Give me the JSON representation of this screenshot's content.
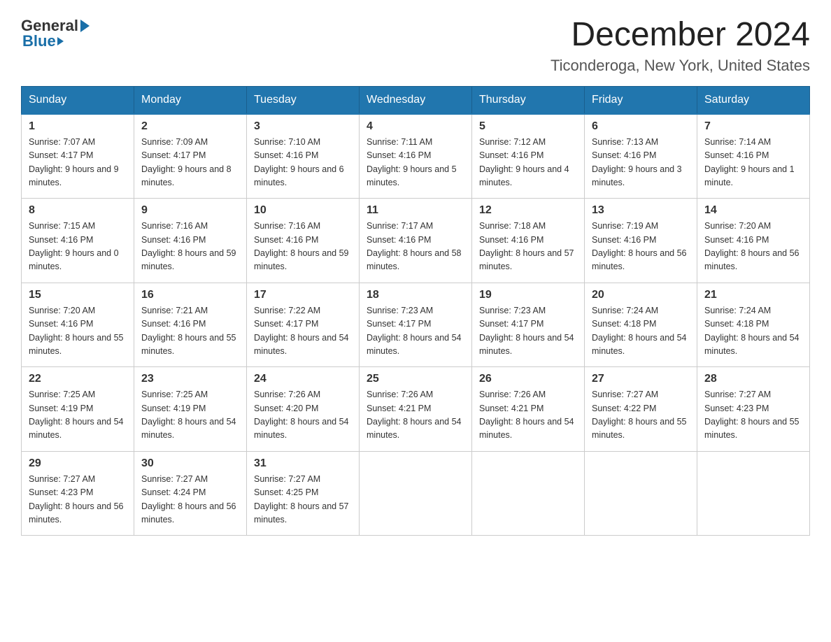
{
  "header": {
    "logo_general": "General",
    "logo_blue": "Blue",
    "title": "December 2024",
    "subtitle": "Ticonderoga, New York, United States"
  },
  "calendar": {
    "days_of_week": [
      "Sunday",
      "Monday",
      "Tuesday",
      "Wednesday",
      "Thursday",
      "Friday",
      "Saturday"
    ],
    "weeks": [
      [
        {
          "day": 1,
          "sunrise": "7:07 AM",
          "sunset": "4:17 PM",
          "daylight": "9 hours and 9 minutes."
        },
        {
          "day": 2,
          "sunrise": "7:09 AM",
          "sunset": "4:17 PM",
          "daylight": "9 hours and 8 minutes."
        },
        {
          "day": 3,
          "sunrise": "7:10 AM",
          "sunset": "4:16 PM",
          "daylight": "9 hours and 6 minutes."
        },
        {
          "day": 4,
          "sunrise": "7:11 AM",
          "sunset": "4:16 PM",
          "daylight": "9 hours and 5 minutes."
        },
        {
          "day": 5,
          "sunrise": "7:12 AM",
          "sunset": "4:16 PM",
          "daylight": "9 hours and 4 minutes."
        },
        {
          "day": 6,
          "sunrise": "7:13 AM",
          "sunset": "4:16 PM",
          "daylight": "9 hours and 3 minutes."
        },
        {
          "day": 7,
          "sunrise": "7:14 AM",
          "sunset": "4:16 PM",
          "daylight": "9 hours and 1 minute."
        }
      ],
      [
        {
          "day": 8,
          "sunrise": "7:15 AM",
          "sunset": "4:16 PM",
          "daylight": "9 hours and 0 minutes."
        },
        {
          "day": 9,
          "sunrise": "7:16 AM",
          "sunset": "4:16 PM",
          "daylight": "8 hours and 59 minutes."
        },
        {
          "day": 10,
          "sunrise": "7:16 AM",
          "sunset": "4:16 PM",
          "daylight": "8 hours and 59 minutes."
        },
        {
          "day": 11,
          "sunrise": "7:17 AM",
          "sunset": "4:16 PM",
          "daylight": "8 hours and 58 minutes."
        },
        {
          "day": 12,
          "sunrise": "7:18 AM",
          "sunset": "4:16 PM",
          "daylight": "8 hours and 57 minutes."
        },
        {
          "day": 13,
          "sunrise": "7:19 AM",
          "sunset": "4:16 PM",
          "daylight": "8 hours and 56 minutes."
        },
        {
          "day": 14,
          "sunrise": "7:20 AM",
          "sunset": "4:16 PM",
          "daylight": "8 hours and 56 minutes."
        }
      ],
      [
        {
          "day": 15,
          "sunrise": "7:20 AM",
          "sunset": "4:16 PM",
          "daylight": "8 hours and 55 minutes."
        },
        {
          "day": 16,
          "sunrise": "7:21 AM",
          "sunset": "4:16 PM",
          "daylight": "8 hours and 55 minutes."
        },
        {
          "day": 17,
          "sunrise": "7:22 AM",
          "sunset": "4:17 PM",
          "daylight": "8 hours and 54 minutes."
        },
        {
          "day": 18,
          "sunrise": "7:23 AM",
          "sunset": "4:17 PM",
          "daylight": "8 hours and 54 minutes."
        },
        {
          "day": 19,
          "sunrise": "7:23 AM",
          "sunset": "4:17 PM",
          "daylight": "8 hours and 54 minutes."
        },
        {
          "day": 20,
          "sunrise": "7:24 AM",
          "sunset": "4:18 PM",
          "daylight": "8 hours and 54 minutes."
        },
        {
          "day": 21,
          "sunrise": "7:24 AM",
          "sunset": "4:18 PM",
          "daylight": "8 hours and 54 minutes."
        }
      ],
      [
        {
          "day": 22,
          "sunrise": "7:25 AM",
          "sunset": "4:19 PM",
          "daylight": "8 hours and 54 minutes."
        },
        {
          "day": 23,
          "sunrise": "7:25 AM",
          "sunset": "4:19 PM",
          "daylight": "8 hours and 54 minutes."
        },
        {
          "day": 24,
          "sunrise": "7:26 AM",
          "sunset": "4:20 PM",
          "daylight": "8 hours and 54 minutes."
        },
        {
          "day": 25,
          "sunrise": "7:26 AM",
          "sunset": "4:21 PM",
          "daylight": "8 hours and 54 minutes."
        },
        {
          "day": 26,
          "sunrise": "7:26 AM",
          "sunset": "4:21 PM",
          "daylight": "8 hours and 54 minutes."
        },
        {
          "day": 27,
          "sunrise": "7:27 AM",
          "sunset": "4:22 PM",
          "daylight": "8 hours and 55 minutes."
        },
        {
          "day": 28,
          "sunrise": "7:27 AM",
          "sunset": "4:23 PM",
          "daylight": "8 hours and 55 minutes."
        }
      ],
      [
        {
          "day": 29,
          "sunrise": "7:27 AM",
          "sunset": "4:23 PM",
          "daylight": "8 hours and 56 minutes."
        },
        {
          "day": 30,
          "sunrise": "7:27 AM",
          "sunset": "4:24 PM",
          "daylight": "8 hours and 56 minutes."
        },
        {
          "day": 31,
          "sunrise": "7:27 AM",
          "sunset": "4:25 PM",
          "daylight": "8 hours and 57 minutes."
        },
        null,
        null,
        null,
        null
      ]
    ]
  }
}
